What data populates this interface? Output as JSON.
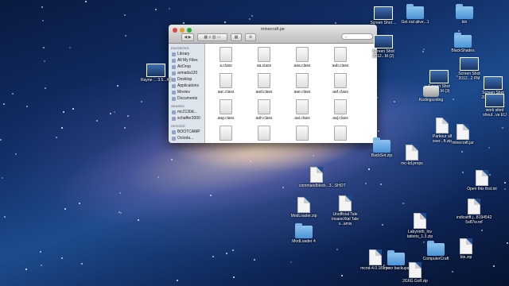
{
  "finder": {
    "title": "minecraft.jar",
    "search_placeholder": "",
    "sidebar": {
      "favorites_label": "FAVORITES",
      "favorites": [
        "Library",
        "All My Files",
        "AirDrop",
        "armada120",
        "Desktop",
        "Applications",
        "Movies",
        "Documents"
      ],
      "shared_label": "SHARED",
      "shared": [
        "mc2130d...",
        "schaffer2000"
      ],
      "devices_label": "DEVICES",
      "devices": [
        "BOOTCAMP",
        "Octoda..."
      ]
    },
    "files": [
      "a.class",
      "aa.class",
      "aaa.class",
      "aab.class",
      "aac.class",
      "aad.class",
      "aae.class",
      "aaf.class",
      "aag.class",
      "aah.class",
      "aai.class",
      "aaj.class",
      "",
      "",
      "",
      ""
    ]
  },
  "desktop_icons": [
    {
      "label": "Screen Shot ..."
    },
    {
      "label": "Get out alive...1"
    },
    {
      "label": "bin"
    },
    {
      "label": "Screen Shot 2012...M (2)"
    },
    {
      "label": "Screen Shot 2012...2 PM"
    },
    {
      "label": "BlackShades"
    },
    {
      "label": "Screen Shot 2012...M (3)"
    },
    {
      "label": "Screen Shot 2012...2.6.58"
    },
    {
      "label": "Kodingsoding"
    },
    {
      "label": "work sited shoul...ve EU"
    },
    {
      "label": "Parkour all over...ft.zip"
    },
    {
      "label": "minecraft.jar"
    },
    {
      "label": "BackSet.zip"
    },
    {
      "label": "mc-kd.props"
    },
    {
      "label": "commandblock...3...SHOT"
    },
    {
      "label": "Unofficial Tale InsaneXtal Tale v...amis"
    },
    {
      "label": "Open this first.txt"
    },
    {
      "label": "ModLoader.zip"
    },
    {
      "label": "ModLoader 4"
    },
    {
      "label": "indicatiff.j...8194542 5x87w.ref"
    },
    {
      "label": "Labyrinth_Inv tations_1.3.zip"
    },
    {
      "label": "ComputerCraft"
    },
    {
      "label": "bin.zip"
    },
    {
      "label": "mcnd-4.0.181 jar"
    },
    {
      "label": "Imoxr backups"
    },
    {
      "label": "2G6G Golf.zip"
    },
    {
      "label": "Rayne ... 3.5...#3"
    }
  ],
  "colors": {
    "close": "#e0443e",
    "minimize": "#dea123",
    "zoom": "#1aab29",
    "accent": "#4a93d6"
  }
}
